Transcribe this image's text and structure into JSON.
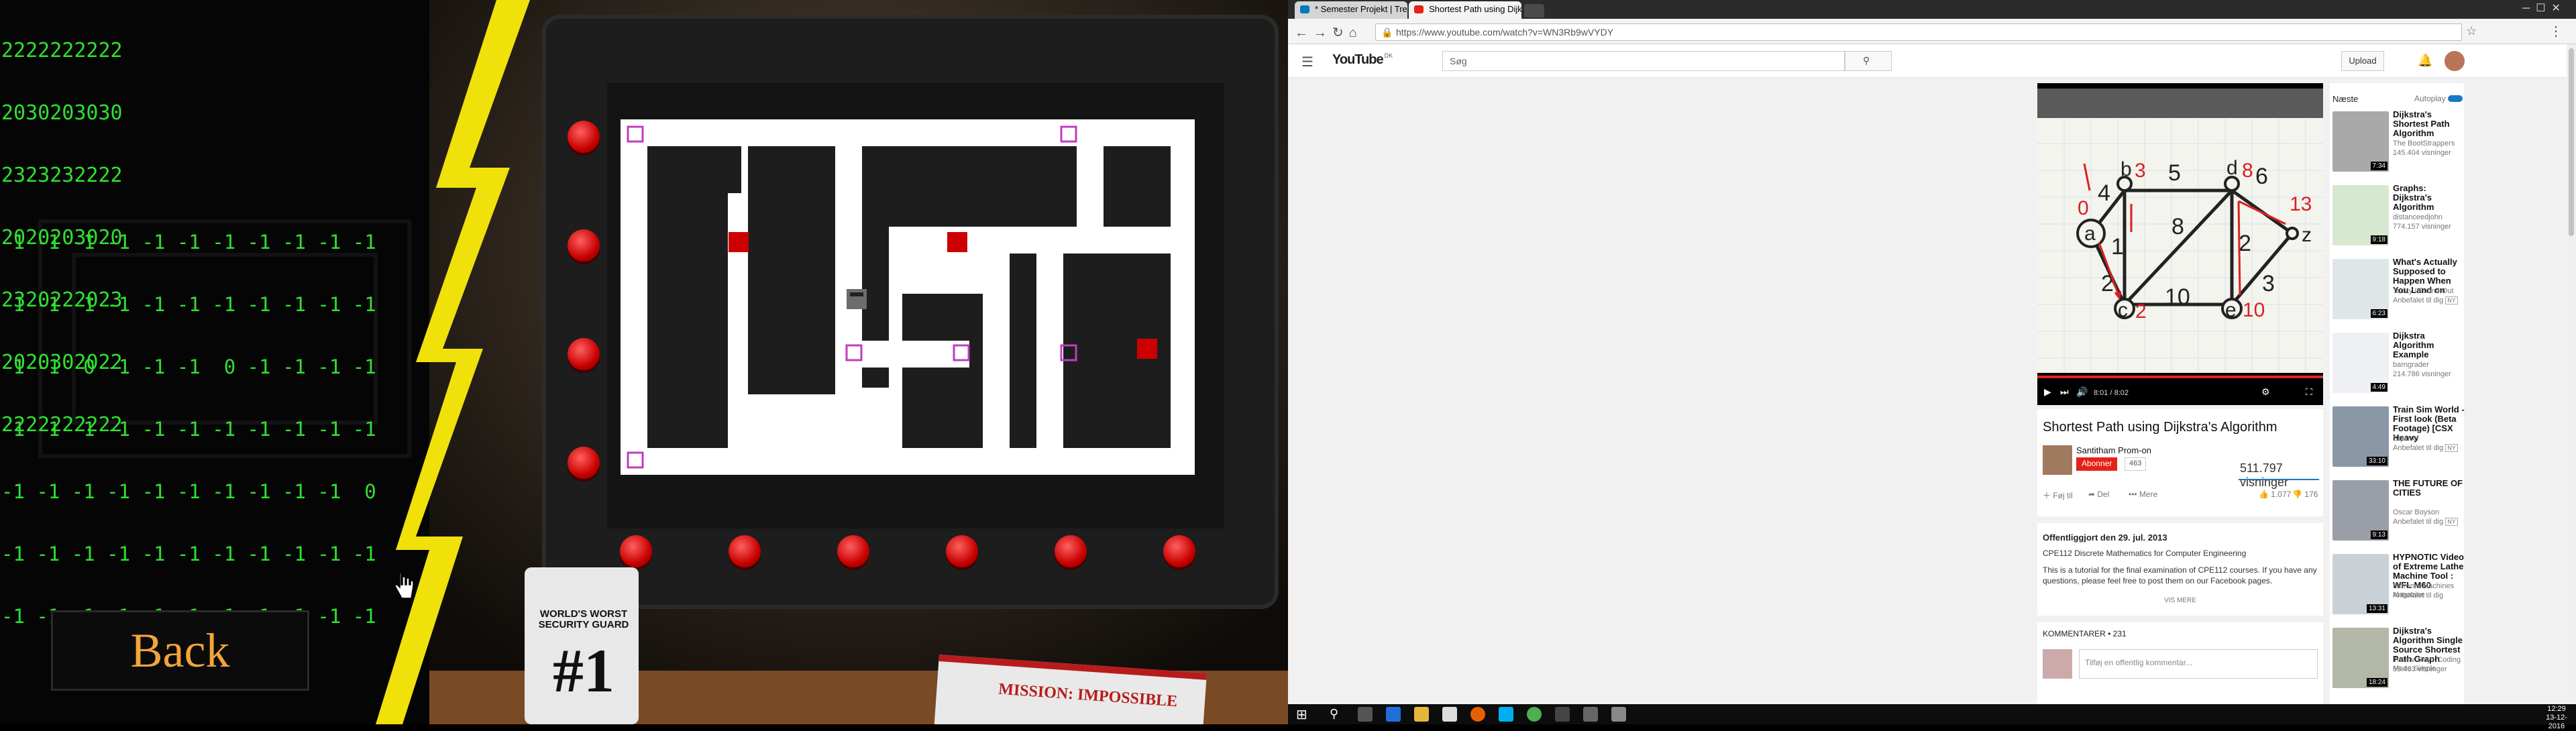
{
  "game": {
    "top_matrix": [
      "2222222222",
      "2030203030",
      "2323232222",
      "2020203020",
      "2320222023",
      "2020302022",
      "2222222222"
    ],
    "top_matrix_tail": [
      "2",
      "2",
      "2",
      "2",
      "2",
      "2",
      "2"
    ],
    "bottom_matrix": [
      "-1 -1 -1 -1 -1 -1 -1 -1 -1 -1 -1",
      "-1 -1 -1 -1 -1 -1 -1 -1 -1 -1 -1",
      "-1 -1  0 -1 -1 -1  0 -1 -1 -1 -1",
      "-1 -1 -1 -1 -1 -1 -1 -1 -1 -1 -1",
      "-1 -1 -1 -1 -1 -1 -1 -1 -1 -1  0",
      "-1 -1 -1 -1 -1 -1 -1 -1 -1 -1 -1",
      "-1 -1 -1 -1 -1 -1 -1 -1 -1 -1 -1"
    ],
    "back_label": "Back",
    "mug_line1": "WORLD'S WORST",
    "mug_line2": "SECURITY GUARD",
    "mug_number": "#1",
    "book_title": "MISSION: IMPOSSIBLE",
    "colors": {
      "matrix": "#2fe02f",
      "bolt": "#f0e10a",
      "back_text": "#f2a43a",
      "red": "#cc0000",
      "marker": "#c03cc0"
    }
  },
  "browser": {
    "tabs": [
      {
        "label": "* Semester Projekt | Trel",
        "icon": "trello-icon"
      },
      {
        "label": "Shortest Path using Dijk",
        "icon": "youtube-icon"
      }
    ],
    "url": "https://www.youtube.com/watch?v=WN3Rb9wVYDY",
    "youtube": {
      "logo": "YouTube",
      "logo_suffix": "DK",
      "search_placeholder": "Søg",
      "upload_label": "Upload"
    },
    "video": {
      "time": "8:01 / 8:02",
      "title": "Shortest Path using Dijkstra's Algorithm",
      "channel": "Santitham Prom-on",
      "subscribe_label": "Abonner",
      "subscribers": "463",
      "views": "511.797 visninger",
      "add_to_label": "Føj til",
      "share_label": "Del",
      "more_label": "Mere",
      "likes": "1.077",
      "dislikes": "176",
      "published": "Offentliggjort den 29. jul. 2013",
      "desc1": "CPE112 Discrete Mathematics for Computer Engineering",
      "desc2": "This is a tutorial for the final examination of CPE112 courses. If you have any questions, please feel free to post them on our Facebook pages.",
      "show_more": "VIS MERE",
      "comments_label": "KOMMENTARER • 231",
      "comment_placeholder": "Tilføj en offentlig kommentar..."
    },
    "graph": {
      "nodes": [
        "a",
        "b",
        "c",
        "d",
        "e",
        "z"
      ],
      "node_values": {
        "a": "0",
        "b": "3",
        "c": "2",
        "d": "8",
        "e": "10",
        "z": "13"
      },
      "edge_weights": [
        "4",
        "2",
        "1",
        "5",
        "8",
        "6",
        "2",
        "3",
        "10"
      ]
    },
    "sidebar": {
      "next_label": "Næste",
      "autoplay_label": "Autoplay",
      "items": [
        {
          "title": "Dijkstra's Shortest Path Algorithm",
          "channel": "The BootStrappers",
          "meta": "145.404 visninger",
          "duration": "7:34"
        },
        {
          "title": "Graphs: Dijkstra's Algorithm",
          "channel": "distanceedjohn",
          "meta": "774.157 visninger",
          "duration": "9:18"
        },
        {
          "title": "What's Actually Supposed to Happen When You Land on",
          "channel": "Today I Found Out",
          "meta": "Anbefalet til dig",
          "badge": "NY",
          "duration": "6:23"
        },
        {
          "title": "Dijkstra Algorithm Example",
          "channel": "barngrader",
          "meta": "214.786 visninger",
          "duration": "4:49"
        },
        {
          "title": "Train Sim World - First look (Beta Footage) [CSX Heavy",
          "channel": "Squirrel",
          "meta": "Anbefalet til dig",
          "badge": "NY",
          "duration": "33:10"
        },
        {
          "title": "THE FUTURE OF CITIES",
          "channel": "Oscar Boyson",
          "meta": "Anbefalet til dig",
          "badge": "NY",
          "duration": "9:13"
        },
        {
          "title": "HYPNOTIC Video of Extreme Lathe Machine Tool : WFL M60",
          "channel": "Extreme Machines Magazine",
          "meta": "Anbefalet til dig",
          "duration": "13:31"
        },
        {
          "title": "Dijkstra's Algorithm Single Source Shortest Path Graph",
          "channel": "Tushar Roy - Coding Made Simple",
          "meta": "55.463 visninger",
          "duration": "18:24"
        }
      ]
    },
    "taskbar": {
      "time": "12:29",
      "date": "13-12-2016"
    }
  }
}
